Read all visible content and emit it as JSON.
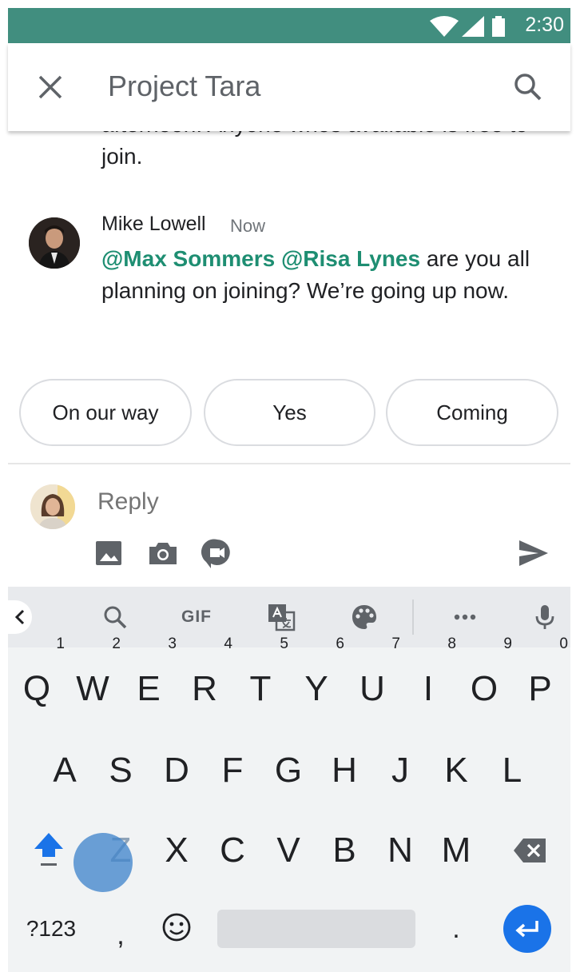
{
  "status_bar": {
    "time": "2:30"
  },
  "app_bar": {
    "title": "Project Tara"
  },
  "messages": {
    "previous_partial": "afternoon. Anyone whos available is free to join.",
    "latest": {
      "sender": "Mike Lowell",
      "time": "Now",
      "mention_1": "@Max Sommers",
      "mention_2": "@Risa Lynes",
      "text": " are you all planning on joining? We’re going up now."
    }
  },
  "smart_replies": [
    "On our way",
    "Yes",
    "Coming"
  ],
  "compose": {
    "placeholder": "Reply"
  },
  "keyboard": {
    "toolbar_gif": "GIF",
    "row1": [
      {
        "key": "Q",
        "hint": "1"
      },
      {
        "key": "W",
        "hint": "2"
      },
      {
        "key": "E",
        "hint": "3"
      },
      {
        "key": "R",
        "hint": "4"
      },
      {
        "key": "T",
        "hint": "5"
      },
      {
        "key": "Y",
        "hint": "6"
      },
      {
        "key": "U",
        "hint": "7"
      },
      {
        "key": "I",
        "hint": "8"
      },
      {
        "key": "O",
        "hint": "9"
      },
      {
        "key": "P",
        "hint": "0"
      }
    ],
    "row2": [
      "A",
      "S",
      "D",
      "F",
      "G",
      "H",
      "J",
      "K",
      "L"
    ],
    "row3": [
      "Z",
      "X",
      "C",
      "V",
      "B",
      "N",
      "M"
    ],
    "symbols_key": "?123",
    "comma_key": ",",
    "period_key": "."
  },
  "colors": {
    "status_bar": "#418e7f",
    "mention": "#1e8e72",
    "enter": "#1a73e8"
  },
  "icons": [
    "close-icon",
    "search-icon",
    "image-icon",
    "camera-icon",
    "video-call-icon",
    "send-icon",
    "chevron-left-icon",
    "gif-icon",
    "translate-icon",
    "palette-icon",
    "more-icon",
    "mic-icon",
    "shift-icon",
    "backspace-icon",
    "emoji-icon",
    "enter-icon"
  ]
}
